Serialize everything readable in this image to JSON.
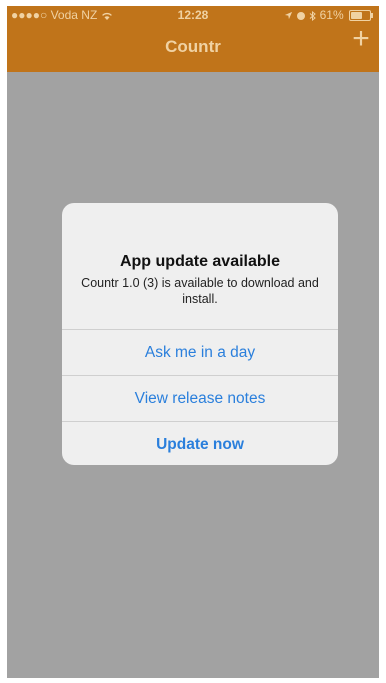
{
  "status_bar": {
    "carrier": "●●●●○ Voda NZ",
    "time": "12:28",
    "battery_text": "61%",
    "battery_level": 0.61
  },
  "nav": {
    "title": "Countr",
    "add_label": "+"
  },
  "alert": {
    "title": "App update available",
    "message": "Countr 1.0 (3) is available to download and install.",
    "actions": [
      {
        "label": "Ask me in a day"
      },
      {
        "label": "View release notes"
      },
      {
        "label": "Update now",
        "bold": true
      }
    ]
  },
  "colors": {
    "nav_bar": "#c0741a",
    "nav_text": "#f0d2a3",
    "backdrop": "#a2a2a2",
    "alert_bg": "#efefef",
    "action_text": "#2a7fdc"
  }
}
